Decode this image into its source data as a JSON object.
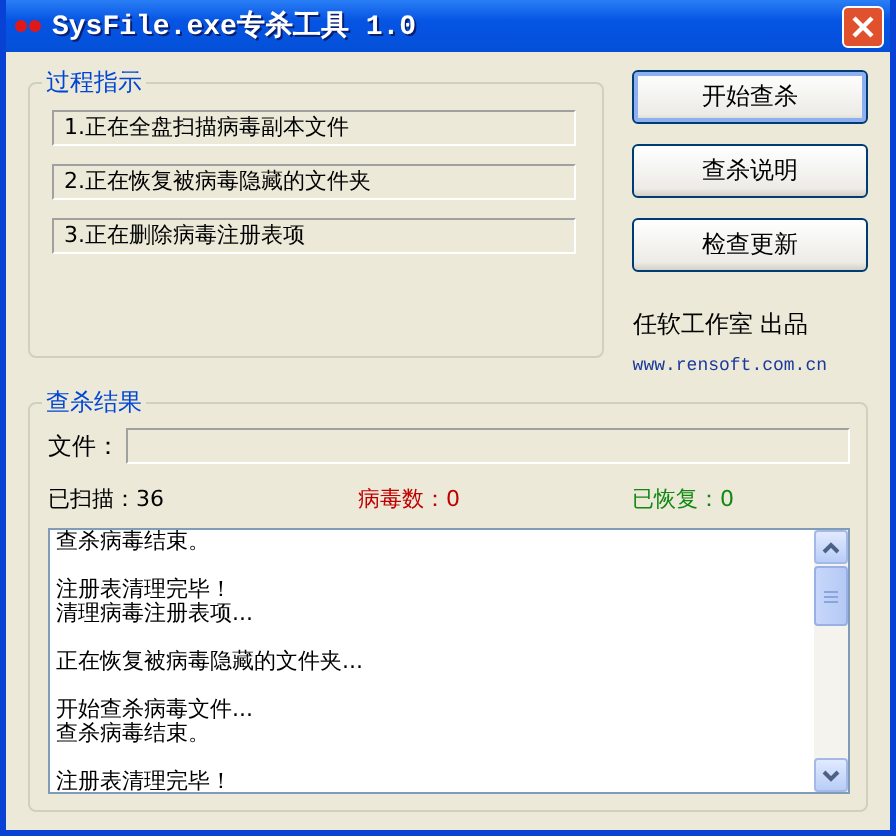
{
  "window": {
    "title": "SysFile.exe专杀工具 1.0"
  },
  "progress_group": {
    "title": "过程指示",
    "steps": [
      {
        "text": "1.正在全盘扫描病毒副本文件"
      },
      {
        "text": "2.正在恢复被病毒隐藏的文件夹"
      },
      {
        "text": "3.正在删除病毒注册表项"
      }
    ]
  },
  "buttons": [
    {
      "label": "开始查杀",
      "default": true
    },
    {
      "label": "查杀说明",
      "default": false
    },
    {
      "label": "检查更新",
      "default": false
    }
  ],
  "credit": "任软工作室 出品",
  "url": "www.rensoft.com.cn",
  "results_group": {
    "title": "查杀结果",
    "file_label": "文件：",
    "stats": [
      {
        "text": "已扫描：36",
        "color": "#000000"
      },
      {
        "text": "病毒数：0",
        "color": "#c00000"
      },
      {
        "text": "已恢复：0",
        "color": "#118811"
      }
    ],
    "log": [
      [
        "查杀病毒结束。"
      ],
      [
        "注册表清理完毕！",
        "清理病毒注册表项..."
      ],
      [
        "正在恢复被病毒隐藏的文件夹..."
      ],
      [
        "开始查杀病毒文件...",
        "查杀病毒结束。"
      ],
      [
        "注册表清理完毕！"
      ]
    ]
  }
}
